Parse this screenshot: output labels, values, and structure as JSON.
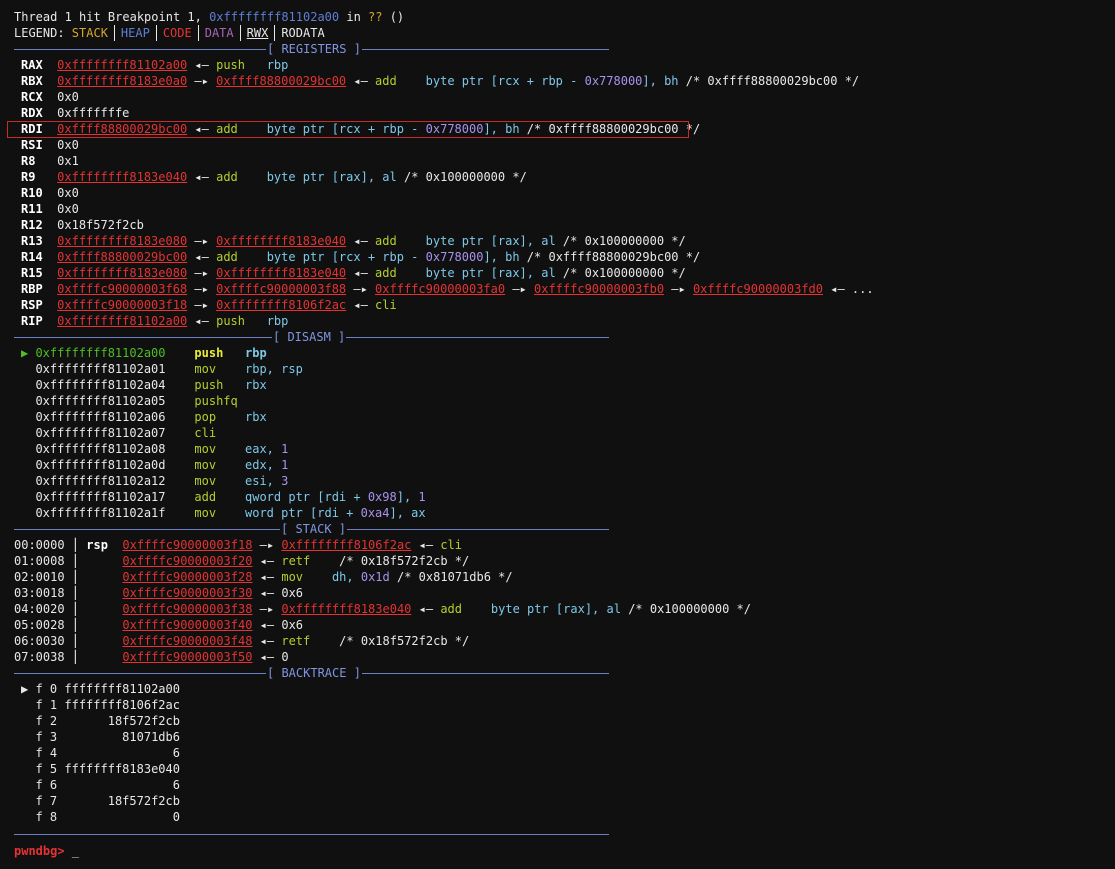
{
  "header": {
    "line": [
      "Thread 1 hit Breakpoint 1, ",
      "0xffffffff81102a00",
      " in ",
      "??",
      " ()"
    ],
    "legend_label": "LEGEND: ",
    "legend": [
      "STACK",
      "HEAP",
      "CODE",
      "DATA",
      "RWX",
      "RODATA"
    ]
  },
  "sections": {
    "registers": "[ REGISTERS ]",
    "disasm": "[ DISASM ]",
    "stack": "[ STACK ]",
    "backtrace": "[ BACKTRACE ]"
  },
  "registers": [
    {
      "name": "RAX",
      "addr": "0xffffffff81102a00",
      "rest": "",
      "ins": "push",
      "ops": "rbp",
      "comment": ""
    },
    {
      "name": "RBX",
      "addr": "0xffffffff8183e0a0",
      "to": "0xffff88800029bc00",
      "ins": "add",
      "ops": "byte ptr [rcx + rbp - 0x778000], bh",
      "comment": "/* 0xffff88800029bc00 */"
    },
    {
      "name": "RCX",
      "value": "0x0"
    },
    {
      "name": "RDX",
      "value": "0xfffffffe"
    },
    {
      "name": "RDI",
      "addr": "0xffff88800029bc00",
      "ins": "add",
      "ops": "byte ptr [rcx + rbp - 0x778000], bh",
      "comment": "/* 0xffff88800029bc00 */"
    },
    {
      "name": "RSI",
      "value": "0x0"
    },
    {
      "name": "R8",
      "value": "0x1"
    },
    {
      "name": "R9",
      "addr": "0xffffffff8183e040",
      "ins": "add",
      "ops": "byte ptr [rax], al",
      "comment": "/* 0x100000000 */"
    },
    {
      "name": "R10",
      "value": "0x0"
    },
    {
      "name": "R11",
      "value": "0x0"
    },
    {
      "name": "R12",
      "value": "0x18f572f2cb"
    },
    {
      "name": "R13",
      "addr": "0xffffffff8183e080",
      "to": "0xffffffff8183e040",
      "ins": "add",
      "ops": "byte ptr [rax], al",
      "comment": "/* 0x100000000 */"
    },
    {
      "name": "R14",
      "addr": "0xffff88800029bc00",
      "ins": "add",
      "ops": "byte ptr [rcx + rbp - 0x778000], bh",
      "comment": "/* 0xffff88800029bc00 */"
    },
    {
      "name": "R15",
      "addr": "0xffffffff8183e080",
      "to": "0xffffffff8183e040",
      "ins": "add",
      "ops": "byte ptr [rax], al",
      "comment": "/* 0x100000000 */"
    },
    {
      "name": "RBP",
      "chain": [
        "0xffffc90000003f68",
        "0xffffc90000003f88",
        "0xffffc90000003fa0",
        "0xffffc90000003fb0",
        "0xffffc90000003fd0"
      ],
      "tail": "..."
    },
    {
      "name": "RSP",
      "addr": "0xffffc90000003f18",
      "to": "0xffffffff8106f2ac",
      "ins": "cli"
    },
    {
      "name": "RIP",
      "addr": "0xffffffff81102a00",
      "ins": "push",
      "ops": "rbp"
    }
  ],
  "disasm": [
    {
      "addr": "0xffffffff81102a00",
      "ins": "push",
      "ops": "rbp",
      "current": true
    },
    {
      "addr": "0xffffffff81102a01",
      "ins": "mov",
      "ops": "rbp, rsp"
    },
    {
      "addr": "0xffffffff81102a04",
      "ins": "push",
      "ops": "rbx"
    },
    {
      "addr": "0xffffffff81102a05",
      "ins": "pushfq",
      "ops": ""
    },
    {
      "addr": "0xffffffff81102a06",
      "ins": "pop",
      "ops": "rbx"
    },
    {
      "addr": "0xffffffff81102a07",
      "ins": "cli",
      "ops": ""
    },
    {
      "addr": "0xffffffff81102a08",
      "ins": "mov",
      "ops": "eax, 1"
    },
    {
      "addr": "0xffffffff81102a0d",
      "ins": "mov",
      "ops": "edx, 1"
    },
    {
      "addr": "0xffffffff81102a12",
      "ins": "mov",
      "ops": "esi, 3"
    },
    {
      "addr": "0xffffffff81102a17",
      "ins": "add",
      "ops": "qword ptr [rdi + 0x98], 1"
    },
    {
      "addr": "0xffffffff81102a1f",
      "ins": "mov",
      "ops": "word ptr [rdi + 0xa4], ax"
    }
  ],
  "stack": [
    {
      "off": "00:0000",
      "reg": "rsp",
      "addr": "0xffffc90000003f18",
      "to": "0xffffffff8106f2ac",
      "ins": "cli"
    },
    {
      "off": "01:0008",
      "addr": "0xffffc90000003f20",
      "ins": "retf",
      "comment": "/* 0x18f572f2cb */"
    },
    {
      "off": "02:0010",
      "addr": "0xffffc90000003f28",
      "ins": "mov",
      "ops": "dh, 0x1d",
      "comment": "/* 0x81071db6 */"
    },
    {
      "off": "03:0018",
      "addr": "0xffffc90000003f30",
      "value": "0x6"
    },
    {
      "off": "04:0020",
      "addr": "0xffffc90000003f38",
      "to": "0xffffffff8183e040",
      "ins": "add",
      "ops": "byte ptr [rax], al",
      "comment": "/* 0x100000000 */"
    },
    {
      "off": "05:0028",
      "addr": "0xffffc90000003f40",
      "value": "0x6"
    },
    {
      "off": "06:0030",
      "addr": "0xffffc90000003f48",
      "ins": "retf",
      "comment": "/* 0x18f572f2cb */"
    },
    {
      "off": "07:0038",
      "addr": "0xffffc90000003f50",
      "value": "0"
    }
  ],
  "backtrace": [
    {
      "frame": "f 0",
      "addr": "ffffffff81102a00",
      "current": true
    },
    {
      "frame": "f 1",
      "addr": "ffffffff8106f2ac"
    },
    {
      "frame": "f 2",
      "addr": "18f572f2cb"
    },
    {
      "frame": "f 3",
      "addr": "81071db6"
    },
    {
      "frame": "f 4",
      "addr": "6"
    },
    {
      "frame": "f 5",
      "addr": "ffffffff8183e040"
    },
    {
      "frame": "f 6",
      "addr": "6"
    },
    {
      "frame": "f 7",
      "addr": "18f572f2cb"
    },
    {
      "frame": "f 8",
      "addr": "0"
    }
  ],
  "prompt": {
    "label": "pwndbg>",
    "cursor": "_"
  }
}
